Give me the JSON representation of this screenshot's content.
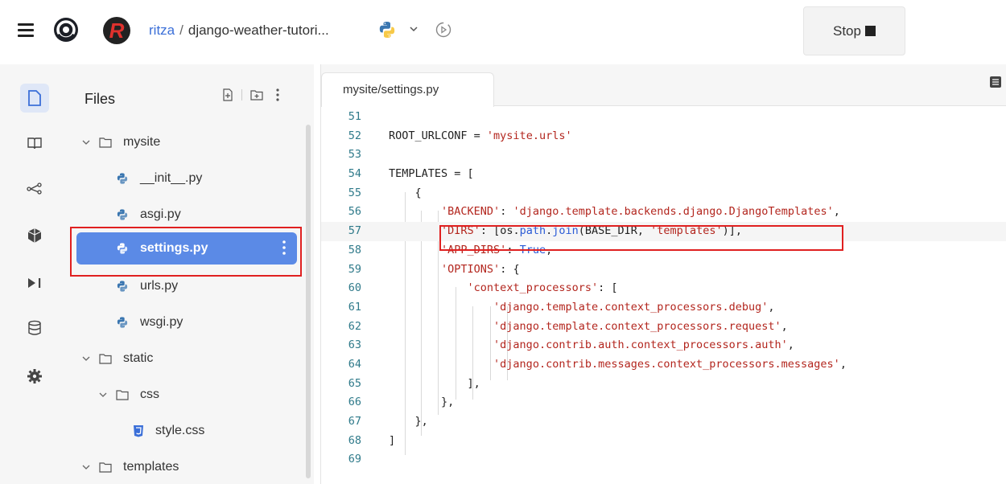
{
  "header": {
    "owner": "ritza",
    "separator": "/",
    "repl_name": "django-weather-tutori...",
    "avatar_letter": "R",
    "stop_label": "Stop"
  },
  "sidebar_rail": {
    "items": [
      "files-icon",
      "book-icon",
      "git-icon",
      "packages-icon",
      "debugger-icon",
      "database-icon",
      "settings-icon"
    ]
  },
  "files_panel": {
    "title": "Files",
    "tree": [
      {
        "label": "mysite",
        "type": "folder",
        "expanded": true
      },
      {
        "label": "__init__.py",
        "type": "python"
      },
      {
        "label": "asgi.py",
        "type": "python"
      },
      {
        "label": "settings.py",
        "type": "python",
        "selected": true
      },
      {
        "label": "urls.py",
        "type": "python"
      },
      {
        "label": "wsgi.py",
        "type": "python"
      },
      {
        "label": "static",
        "type": "folder",
        "expanded": true
      },
      {
        "label": "css",
        "type": "folder",
        "expanded": true
      },
      {
        "label": "style.css",
        "type": "css"
      },
      {
        "label": "templates",
        "type": "folder",
        "expanded": true
      }
    ]
  },
  "editor": {
    "tab_label": "mysite/settings.py",
    "current_line": 57,
    "lines": [
      {
        "n": "51",
        "code": ""
      },
      {
        "n": "52",
        "code": "ROOT_URLCONF = 'mysite.urls'"
      },
      {
        "n": "53",
        "code": ""
      },
      {
        "n": "54",
        "code": "TEMPLATES = ["
      },
      {
        "n": "55",
        "code": "    {"
      },
      {
        "n": "56",
        "code": "        'BACKEND': 'django.template.backends.django.DjangoTemplates',"
      },
      {
        "n": "57",
        "code": "        'DIRS': [os.path.join(BASE_DIR, 'templates')],"
      },
      {
        "n": "58",
        "code": "        'APP_DIRS': True,"
      },
      {
        "n": "59",
        "code": "        'OPTIONS': {"
      },
      {
        "n": "60",
        "code": "            'context_processors': ["
      },
      {
        "n": "61",
        "code": "                'django.template.context_processors.debug',"
      },
      {
        "n": "62",
        "code": "                'django.template.context_processors.request',"
      },
      {
        "n": "63",
        "code": "                'django.contrib.auth.context_processors.auth',"
      },
      {
        "n": "64",
        "code": "                'django.contrib.messages.context_processors.messages',"
      },
      {
        "n": "65",
        "code": "            ],"
      },
      {
        "n": "66",
        "code": "        },"
      },
      {
        "n": "67",
        "code": "    },"
      },
      {
        "n": "68",
        "code": "]"
      },
      {
        "n": "69",
        "code": ""
      }
    ]
  },
  "colors": {
    "accent": "#5b8ae6",
    "highlight": "#e02020",
    "string": "#b3261e",
    "keyword": "#2b5bd6",
    "line_number": "#2f7a8a"
  }
}
